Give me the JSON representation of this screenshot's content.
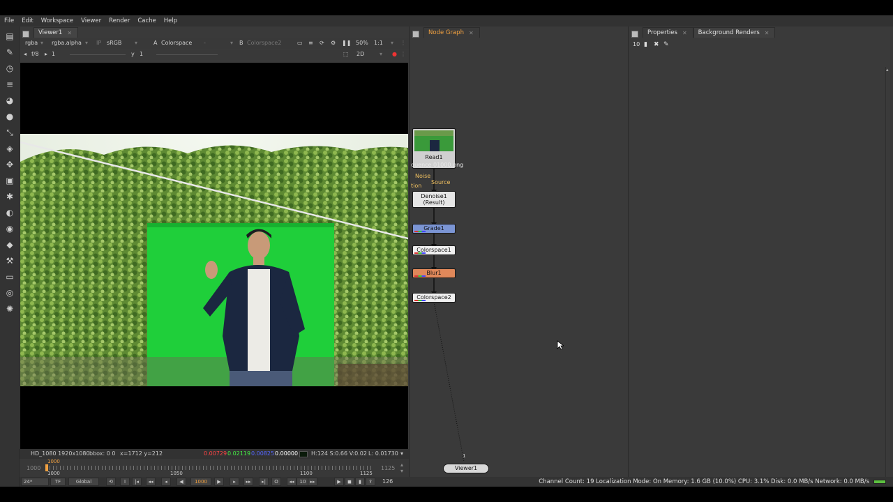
{
  "menu": [
    "File",
    "Edit",
    "Workspace",
    "Viewer",
    "Render",
    "Cache",
    "Help"
  ],
  "viewer": {
    "tab": "Viewer1",
    "channels": "rgba",
    "alpha": "rgba.alpha",
    "ip": "IP",
    "lut": "sRGB",
    "a_label": "A",
    "a_input": "Colorspace",
    "dash": "-",
    "b_label": "B",
    "b_input": "Colorspace2",
    "zoom": "50%",
    "ratio": "1:1",
    "fstop": "f/8",
    "gain": "1",
    "gamma_label": "y",
    "gamma": "1",
    "mode": "2D"
  },
  "info": {
    "format": "HD_1080 1920x1080",
    "bbox": "bbox: 0 0",
    "coords": "x=1712 y=212",
    "r": "0.00729",
    "g": "0.02119",
    "b": "0.00825",
    "a": "0.00000",
    "hsv": "H:124 S:0.66 V:0.02",
    "lum": "L: 0.01730"
  },
  "timeline": {
    "start": "1000",
    "end": "1125",
    "marker": "1000",
    "ticks": [
      "1000",
      "1050",
      "1100",
      "1125"
    ]
  },
  "transport": {
    "fps": "24*",
    "tf": "TF",
    "global": "Global",
    "current": "1000",
    "step": "10",
    "frames": "126"
  },
  "nodegraph": {
    "tab": "Node Graph",
    "read_label": "Read1",
    "read_file": "quence 01000.png",
    "noise": "Noise",
    "tion": "tion",
    "source": "Source",
    "denoise": "Denoise1",
    "denoise_sub": "(Result)",
    "grade": "Grade1",
    "cs1": "Colorspace1",
    "blur": "Blur1",
    "cs2": "Colorspace2",
    "viewer_node": "Viewer1",
    "viewer_input": "1"
  },
  "properties": {
    "tab": "Properties",
    "tab2": "Background Renders",
    "count": "10"
  },
  "status": "Channel Count: 19  Localization Mode: On  Memory: 1.6 GB (10.0%)  CPU: 3.1%  Disk: 0.0 MB/s  Network: 0.0 MB/s",
  "colors": {
    "grade": "#7b95d4",
    "blur": "#e0885a",
    "bg": "#3a3a3a",
    "red": "#ff4444",
    "green": "#44ff44",
    "blue": "#5566ff",
    "accent": "#f0a040"
  }
}
